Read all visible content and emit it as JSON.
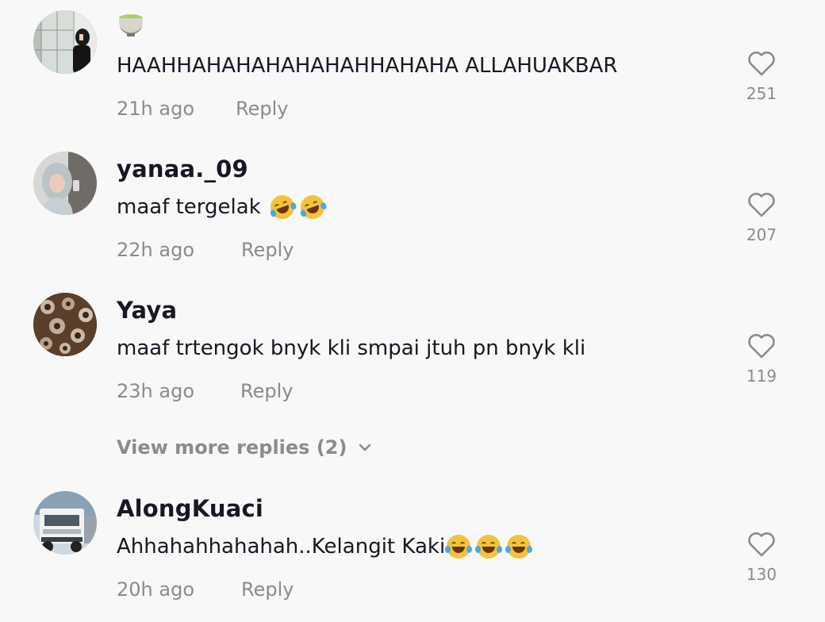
{
  "comments": [
    {
      "username": "",
      "text": "HAAHHAHAHAHAHAHAHHAHAHA ALLAHUAKBAR",
      "time": "21h ago",
      "reply": "Reply",
      "likes": "251",
      "avatar_icon": "avatar-photo-woman-mirror"
    },
    {
      "username": "yanaa._09",
      "text": "maaf tergelak",
      "time": "22h ago",
      "reply": "Reply",
      "likes": "207",
      "avatar_icon": "avatar-photo-hijab"
    },
    {
      "username": "Yaya",
      "text": "maaf trtengok bnyk kli smpai jtuh pn bnyk kli",
      "time": "23h ago",
      "reply": "Reply",
      "likes": "119",
      "avatar_icon": "avatar-photo-pattern"
    },
    {
      "username": "AlongKuaci",
      "text": "Ahhahahhahahah..Kelangit Kaki",
      "time": "20h ago",
      "reply": "Reply",
      "likes": "130",
      "avatar_icon": "avatar-photo-truck"
    }
  ],
  "view_more": "View more replies (2)",
  "colors": {
    "background": "#f8f8f8",
    "primary_text": "#161823",
    "secondary_text": "#8a8b91"
  }
}
